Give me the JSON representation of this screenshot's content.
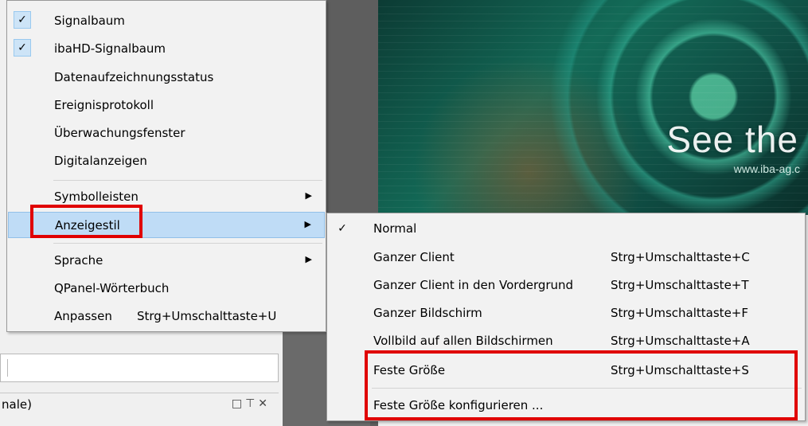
{
  "banner": {
    "title": "See the",
    "url": "www.iba-ag.c"
  },
  "panel": {
    "title": "nale)",
    "icons": [
      "restore-icon",
      "pin-icon",
      "close-icon"
    ],
    "icon_glyphs": "□ ⊤ ✕"
  },
  "menu": {
    "items": [
      {
        "label": "Signalbaum",
        "checked": true
      },
      {
        "label": "ibaHD-Signalbaum",
        "checked": true
      },
      {
        "label": "Datenaufzeichnungsstatus"
      },
      {
        "label": "Ereignisprotokoll"
      },
      {
        "label": "Überwachungsfenster"
      },
      {
        "label": "Digitalanzeigen"
      },
      {
        "label": "Symbolleisten",
        "submenu": true
      },
      {
        "label": "Anzeigestil",
        "submenu": true,
        "highlighted": true
      },
      {
        "label": "Sprache",
        "submenu": true
      },
      {
        "label": "QPanel-Wörterbuch"
      },
      {
        "label": "Anpassen",
        "shortcut": "Strg+Umschalttaste+U"
      }
    ],
    "check_glyph": "✓",
    "arrow_glyph": "▶"
  },
  "submenu": {
    "items": [
      {
        "label": "Normal",
        "shortcut": "",
        "checked": true
      },
      {
        "label": "Ganzer Client",
        "shortcut": "Strg+Umschalttaste+C"
      },
      {
        "label": "Ganzer Client in den Vordergrund",
        "shortcut": "Strg+Umschalttaste+T"
      },
      {
        "label": "Ganzer Bildschirm",
        "shortcut": "Strg+Umschalttaste+F"
      },
      {
        "label": "Vollbild auf allen Bildschirmen",
        "shortcut": "Strg+Umschalttaste+A"
      },
      {
        "label": "Feste Größe",
        "shortcut": "Strg+Umschalttaste+S"
      },
      {
        "label": "Feste Größe konfigurieren ...",
        "shortcut": ""
      }
    ]
  },
  "colors": {
    "highlight": "#bfdcf6",
    "annotation": "#e00000",
    "check_bg": "#cde4f7"
  }
}
